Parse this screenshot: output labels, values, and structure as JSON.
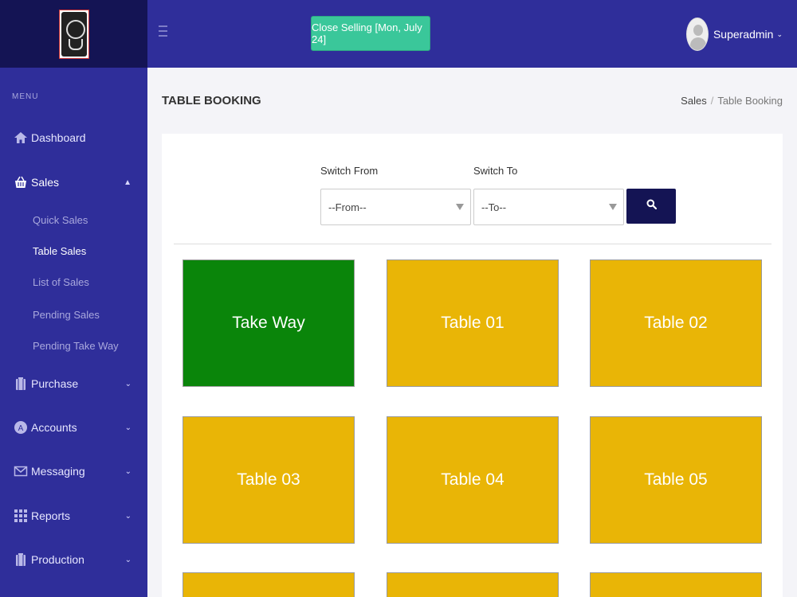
{
  "sidebar": {
    "menu_heading": "MENU",
    "items": [
      {
        "label": "Dashboard"
      },
      {
        "label": "Sales"
      },
      {
        "label": "Purchase"
      },
      {
        "label": "Accounts"
      },
      {
        "label": "Messaging"
      },
      {
        "label": "Reports"
      },
      {
        "label": "Production"
      }
    ],
    "sales_sub": [
      {
        "label": "Quick Sales"
      },
      {
        "label": "Table Sales"
      },
      {
        "label": "List of Sales"
      },
      {
        "label": "Pending Sales"
      },
      {
        "label": "Pending Take Way"
      }
    ]
  },
  "header": {
    "close_selling": "Close Selling [Mon, July 24]",
    "user_name": "Superadmin"
  },
  "page": {
    "title": "TABLE BOOKING",
    "breadcrumb": [
      "Sales",
      "Table Booking"
    ]
  },
  "switch": {
    "from_label": "Switch From",
    "to_label": "Switch To",
    "from_value": "--From--",
    "to_value": "--To--"
  },
  "tiles": [
    {
      "label": "Take Way",
      "status": "green"
    },
    {
      "label": "Table 01",
      "status": "yellow"
    },
    {
      "label": "Table 02",
      "status": "yellow"
    },
    {
      "label": "Table 03",
      "status": "yellow"
    },
    {
      "label": "Table 04",
      "status": "yellow"
    },
    {
      "label": "Table 05",
      "status": "yellow"
    }
  ],
  "colors": {
    "sidebar": "#2f2e9a",
    "header_dark": "#141454",
    "accent_green_button": "#3ac79a",
    "tile_green": "#0a850a",
    "tile_yellow": "#e9b506"
  }
}
